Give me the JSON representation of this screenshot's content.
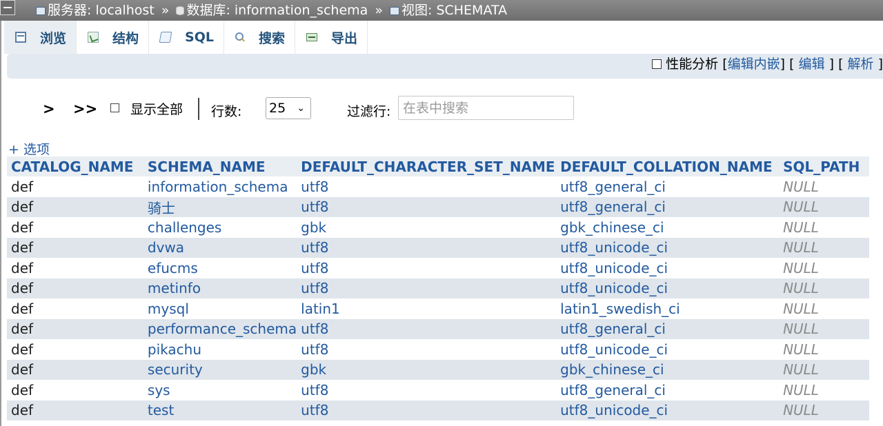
{
  "breadcrumb": {
    "server_label": "服务器: localhost",
    "separator": "»",
    "database_label": "数据库: information_schema",
    "view_label": "视图: SCHEMATA"
  },
  "tabs": [
    {
      "label": "浏览",
      "icon": "browse-icon",
      "active": true
    },
    {
      "label": "结构",
      "icon": "structure-icon",
      "active": false
    },
    {
      "label": "SQL",
      "icon": "sql-icon",
      "active": false
    },
    {
      "label": "搜索",
      "icon": "search-icon",
      "active": false
    },
    {
      "label": "导出",
      "icon": "export-icon",
      "active": false
    }
  ],
  "profiling": {
    "label": "性能分析",
    "edit_inline": "编辑内嵌",
    "edit": "编辑",
    "explain": "解析"
  },
  "nav": {
    "next": ">",
    "last": ">>",
    "show_all": "显示全部",
    "rows_label": "行数:",
    "rows_value": "25",
    "filter_label": "过滤行:",
    "filter_placeholder": "在表中搜索"
  },
  "options_link": "+ 选项",
  "table": {
    "headers": [
      "CATALOG_NAME",
      "SCHEMA_NAME",
      "DEFAULT_CHARACTER_SET_NAME",
      "DEFAULT_COLLATION_NAME",
      "SQL_PATH"
    ],
    "rows": [
      [
        "def",
        "information_schema",
        "utf8",
        "utf8_general_ci",
        "NULL"
      ],
      [
        "def",
        "骑士",
        "utf8",
        "utf8_general_ci",
        "NULL"
      ],
      [
        "def",
        "challenges",
        "gbk",
        "gbk_chinese_ci",
        "NULL"
      ],
      [
        "def",
        "dvwa",
        "utf8",
        "utf8_unicode_ci",
        "NULL"
      ],
      [
        "def",
        "efucms",
        "utf8",
        "utf8_unicode_ci",
        "NULL"
      ],
      [
        "def",
        "metinfo",
        "utf8",
        "utf8_unicode_ci",
        "NULL"
      ],
      [
        "def",
        "mysql",
        "latin1",
        "latin1_swedish_ci",
        "NULL"
      ],
      [
        "def",
        "performance_schema",
        "utf8",
        "utf8_general_ci",
        "NULL"
      ],
      [
        "def",
        "pikachu",
        "utf8",
        "utf8_unicode_ci",
        "NULL"
      ],
      [
        "def",
        "security",
        "gbk",
        "gbk_chinese_ci",
        "NULL"
      ],
      [
        "def",
        "sys",
        "utf8",
        "utf8_general_ci",
        "NULL"
      ],
      [
        "def",
        "test",
        "utf8",
        "utf8_unicode_ci",
        "NULL"
      ]
    ]
  },
  "colors": {
    "link": "#235a9f",
    "header_bg": "#e9eef3",
    "stripe_bg": "#dfe5eb",
    "topbar_bg": "#7a7a7a"
  }
}
